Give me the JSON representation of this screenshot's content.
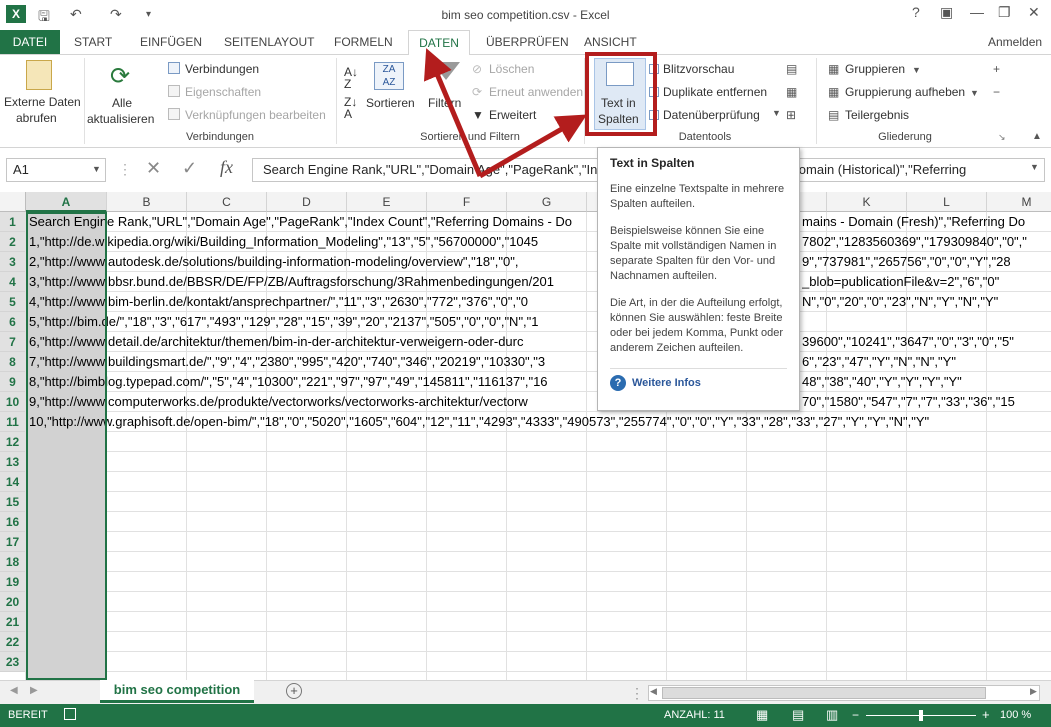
{
  "window": {
    "title": "bim seo competition.csv - Excel",
    "help": "?",
    "app_icon": "X",
    "login": "Anmelden"
  },
  "tabs": [
    "DATEI",
    "START",
    "EINFÜGEN",
    "SEITENLAYOUT",
    "FORMELN",
    "DATEN",
    "ÜBERPRÜFEN",
    "ANSICHT"
  ],
  "ribbon": {
    "external_data_1": "Externe Daten",
    "external_data_2": "abrufen",
    "refresh_1": "Alle",
    "refresh_2": "aktualisieren",
    "connections": "Verbindungen",
    "properties": "Eigenschaften",
    "edit_links": "Verknüpfungen bearbeiten",
    "group_connections": "Verbindungen",
    "sort": "Sortieren",
    "filter": "Filtern",
    "clear": "Löschen",
    "reapply": "Erneut anwenden",
    "advanced": "Erweitert",
    "group_sort": "Sortieren und Filtern",
    "text_to_columns_1": "Text in",
    "text_to_columns_2": "Spalten",
    "flash_fill": "Blitzvorschau",
    "remove_dup": "Duplikate entfernen",
    "validation": "Datenüberprüfung",
    "group_tools": "Datentools",
    "group": "Gruppieren",
    "ungroup": "Gruppierung aufheben",
    "subtotal": "Teilergebnis",
    "group_outline": "Gliederung"
  },
  "formula_bar": {
    "name_box": "A1",
    "fx": "fx",
    "formula": "Search Engine Rank,\"URL\",\"Domain Age\",\"PageRank\",\"Index Count\",\"Referring Domains - Domain (Historical)\",\"Referring"
  },
  "columns": [
    "A",
    "B",
    "C",
    "D",
    "E",
    "F",
    "G",
    "H",
    "I",
    "J",
    "K",
    "L",
    "M"
  ],
  "rows": [
    "1",
    "2",
    "3",
    "4",
    "5",
    "6",
    "7",
    "8",
    "9",
    "10",
    "11",
    "12",
    "13",
    "14",
    "15",
    "16",
    "17",
    "18",
    "19",
    "20",
    "21",
    "22",
    "23"
  ],
  "cells": [
    "Search Engine Rank,\"URL\",\"Domain Age\",\"PageRank\",\"Index Count\",\"Referring Domains - Do",
    "1,\"http://de.wikipedia.org/wiki/Building_Information_Modeling\",\"13\",\"5\",\"56700000\",\"1045",
    "2,\"http://www.autodesk.de/solutions/building-information-modeling/overview\",\"18\",\"0\",",
    "3,\"http://www.bbsr.bund.de/BBSR/DE/FP/ZB/Auftragsforschung/3Rahmenbedingungen/201",
    "4,\"http://www.bim-berlin.de/kontakt/ansprechpartner/\",\"11\",\"3\",\"2630\",\"772\",\"376\",\"0\",\"0",
    "5,\"http://bim.de/\",\"18\",\"3\",\"617\",\"493\",\"129\",\"28\",\"15\",\"39\",\"20\",\"2137\",\"505\",\"0\",\"0\",\"N\",\"1",
    "6,\"http://www.detail.de/architektur/themen/bim-in-der-architektur-verweigern-oder-durc",
    "7,\"http://www.buildingsmart.de/\",\"9\",\"4\",\"2380\",\"995\",\"420\",\"740\",\"346\",\"20219\",\"10330\",\"3",
    "8,\"http://bimblog.typepad.com/\",\"5\",\"4\",\"10300\",\"221\",\"97\",\"97\",\"49\",\"145811\",\"116137\",\"16",
    "9,\"http://www.computerworks.de/produkte/vectorworks/vectorworks-architektur/vectorw",
    "10,\"http://www.graphisoft.de/open-bim/\",\"18\",\"0\",\"5020\",\"1605\",\"604\",\"12\",\"11\",\"4293\",\"4333\",\"490573\",\"255774\",\"0\",\"0\",\"Y\",\"33\",\"28\",\"33\",\"27\",\"Y\",\"Y\",\"N\",\"Y\""
  ],
  "cells_right": [
    "mains - Domain (Fresh)\",\"Referring Do",
    "7802\",\"1283560369\",\"179309840\",\"0\",\"",
    "9\",\"737981\",\"265756\",\"0\",\"0\",\"Y\",\"28",
    "_blob=publicationFile&v=2\",\"6\",\"0\"",
    "N\",\"0\",\"20\",\"0\",\"23\",\"N\",\"Y\",\"N\",\"Y\"",
    "",
    "39600\",\"10241\",\"3647\",\"0\",\"3\",\"0\",\"5\"",
    "6\",\"23\",\"47\",\"Y\",\"N\",\"N\",\"Y\"",
    "48\",\"38\",\"40\",\"Y\",\"Y\",\"Y\",\"Y\"",
    "70\",\"1580\",\"547\",\"7\",\"7\",\"33\",\"36\",\"15"
  ],
  "tooltip": {
    "title": "Text in Spalten",
    "p1": "Eine einzelne Textspalte in mehrere Spalten aufteilen.",
    "p2": "Beispielsweise können Sie eine Spalte mit vollständigen Namen in separate Spalten für den Vor- und Nachnamen aufteilen.",
    "p3": "Die Art, in der die Aufteilung erfolgt, können Sie auswählen: feste Breite oder bei jedem Komma, Punkt oder anderem Zeichen aufteilen.",
    "more": "Weitere Infos"
  },
  "sheet_tab": "bim seo competition",
  "status": {
    "ready": "BEREIT",
    "count": "ANZAHL: 11",
    "zoom": "100 %"
  },
  "colors": {
    "accent": "#217346",
    "annotation": "#b31d1d"
  }
}
